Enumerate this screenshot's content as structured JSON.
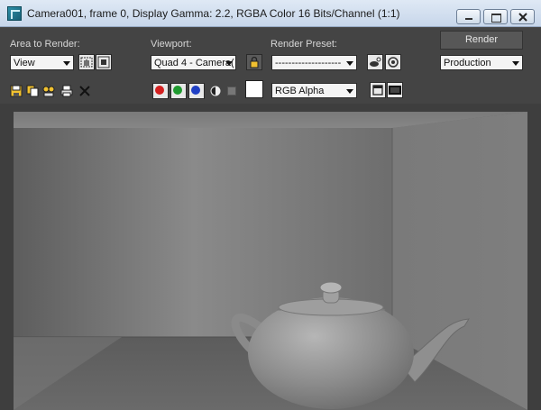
{
  "window": {
    "title": "Camera001, frame 0, Display Gamma: 2.2, RGBA Color 16 Bits/Channel (1:1)"
  },
  "area_to_render": {
    "label": "Area to Render:",
    "value": "View"
  },
  "viewport": {
    "label": "Viewport:",
    "value": "Quad 4 - Camera("
  },
  "render_preset": {
    "label": "Render Preset:",
    "value": "--------------------"
  },
  "render_button": {
    "label": "Render"
  },
  "production": {
    "value": "Production"
  },
  "channel": {
    "value": "RGB Alpha"
  },
  "colors": {
    "red_channel": "#d42020",
    "green_channel": "#1f9a2f",
    "blue_channel": "#1f3fc4",
    "background_swatch": "#ffffff"
  }
}
